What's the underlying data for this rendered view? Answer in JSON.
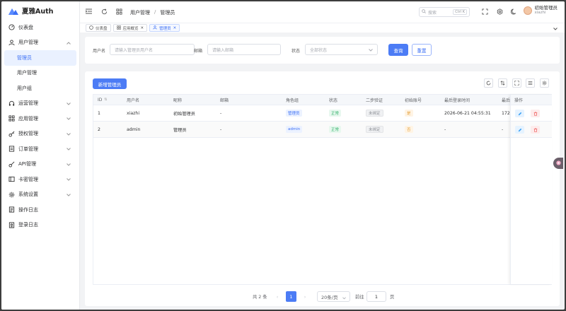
{
  "app": {
    "title": "夏雅Auth"
  },
  "sidebar": {
    "items": [
      {
        "label": "仪表盘",
        "icon": "dashboard-icon"
      },
      {
        "label": "用户管理",
        "icon": "user-icon",
        "expanded": true
      },
      {
        "label": "管理员",
        "active": true
      },
      {
        "label": "用户管理"
      },
      {
        "label": "用户组"
      },
      {
        "label": "运营管理",
        "icon": "headset-icon"
      },
      {
        "label": "应用管理",
        "icon": "grid-icon"
      },
      {
        "label": "授权管理",
        "icon": "key-icon"
      },
      {
        "label": "订单管理",
        "icon": "order-icon"
      },
      {
        "label": "API管理",
        "icon": "api-key-icon"
      },
      {
        "label": "卡密管理",
        "icon": "card-icon"
      },
      {
        "label": "系统设置",
        "icon": "gear-icon"
      },
      {
        "label": "操作日志",
        "icon": "log-icon"
      },
      {
        "label": "登录日志",
        "icon": "login-log-icon"
      }
    ]
  },
  "header": {
    "breadcrumb": [
      "用户管理",
      "管理员"
    ],
    "search_placeholder": "搜索",
    "search_shortcut": "Ctrl K",
    "user_name": "初始管理员",
    "user_sub": "xiazhi"
  },
  "tabs": [
    {
      "label": "仪表盘"
    },
    {
      "label": "应用概览"
    },
    {
      "label": "管理员",
      "active": true
    }
  ],
  "filter": {
    "username_label": "用户名",
    "username_placeholder": "请输入管理员用户名",
    "email_label": "邮箱",
    "email_placeholder": "请输入邮箱",
    "status_label": "状态",
    "status_placeholder": "全部状态",
    "query_label": "查询",
    "reset_label": "重置"
  },
  "table": {
    "add_label": "新增管理员",
    "headers": {
      "id": "ID",
      "username": "用户名",
      "nickname": "昵称",
      "email": "邮箱",
      "role": "角色组",
      "status": "状态",
      "twofa": "二步验证",
      "initial": "初始账号",
      "lastlogin": "最后登录时间",
      "lastip": "最后",
      "ops": "操作"
    },
    "rows": [
      {
        "id": "1",
        "username": "xiazhi",
        "nickname": "初始管理员",
        "email": "-",
        "role": "管理员",
        "status": "正常",
        "twofa": "未绑定",
        "initial": "是",
        "lastlogin": "2026-06-21 04:55:31",
        "lastip": "172"
      },
      {
        "id": "2",
        "username": "admin",
        "nickname": "管理员",
        "email": "-",
        "role": "admin",
        "status": "正常",
        "twofa": "未绑定",
        "initial": "否",
        "lastlogin": "-",
        "lastip": "-"
      }
    ]
  },
  "pagination": {
    "total": "共 2 条",
    "current_page": "1",
    "page_size": "20条/页",
    "goto_label": "前往",
    "goto_value": "1",
    "page_suffix": "页"
  }
}
